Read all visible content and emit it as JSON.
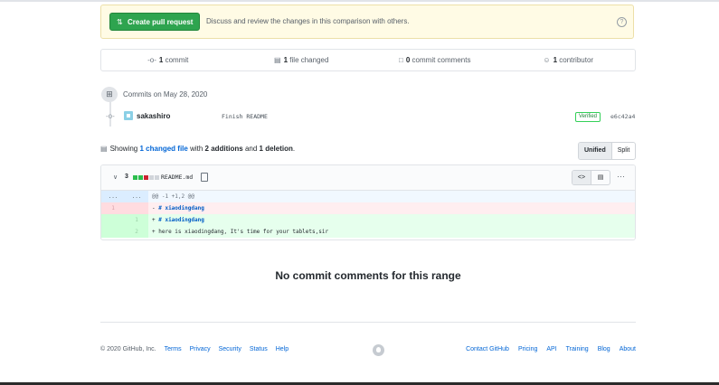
{
  "banner": {
    "button_icon": "pull-request-icon",
    "button_label": "Create pull request",
    "description": "Discuss and review the changes in this comparison with others.",
    "help_glyph": "?"
  },
  "summary": {
    "commits_count": "1",
    "commits_label": " commit",
    "files_count": "1",
    "files_label": " file changed",
    "comments_count": "0",
    "comments_label": " commit comments",
    "contributors_count": "1",
    "contributors_label": " contributor"
  },
  "commits": {
    "date_label": "Commits on May 28, 2020",
    "items": [
      {
        "author": "sakashiro",
        "message": "Finish README",
        "badge": "Verified",
        "sha": "e6c42a4"
      }
    ]
  },
  "toc": {
    "prefix": "Showing ",
    "link": "1 changed file",
    "middle": " with ",
    "additions": "2 additions",
    "and": " and ",
    "deletions": "1 deletion",
    "suffix": "."
  },
  "view_toggle": {
    "unified": "Unified",
    "split": "Split"
  },
  "file": {
    "changes_count": "3",
    "diffstat": [
      "add",
      "add",
      "del",
      "neu",
      "neu"
    ],
    "name": "README.md",
    "rows": [
      {
        "type": "hunk",
        "old": "...",
        "new": "...",
        "marker": "",
        "prefix": "",
        "head": "",
        "text": "@@ -1 +1,2 @@"
      },
      {
        "type": "del",
        "old": "1",
        "new": "",
        "marker": "- ",
        "prefix": "",
        "head": "# xiaodingdang",
        "text": ""
      },
      {
        "type": "add",
        "old": "",
        "new": "1",
        "marker": "+ ",
        "prefix": "",
        "head": "# xiaodingdang",
        "text": ""
      },
      {
        "type": "add",
        "old": "",
        "new": "2",
        "marker": "+ ",
        "prefix": "",
        "head": "",
        "text": "here is xiaodingdang, It's time for your tablets,sir"
      }
    ]
  },
  "empty_state": "No commit comments for this range",
  "footer": {
    "copyright": "© 2020 GitHub, Inc.",
    "left_links": [
      "Terms",
      "Privacy",
      "Security",
      "Status",
      "Help"
    ],
    "right_links": [
      "Contact GitHub",
      "Pricing",
      "API",
      "Training",
      "Blog",
      "About"
    ]
  },
  "colors": {
    "primary_button": "#2ea44f",
    "link": "#0366d6",
    "addition": "#e6ffed",
    "deletion": "#ffeef0"
  }
}
